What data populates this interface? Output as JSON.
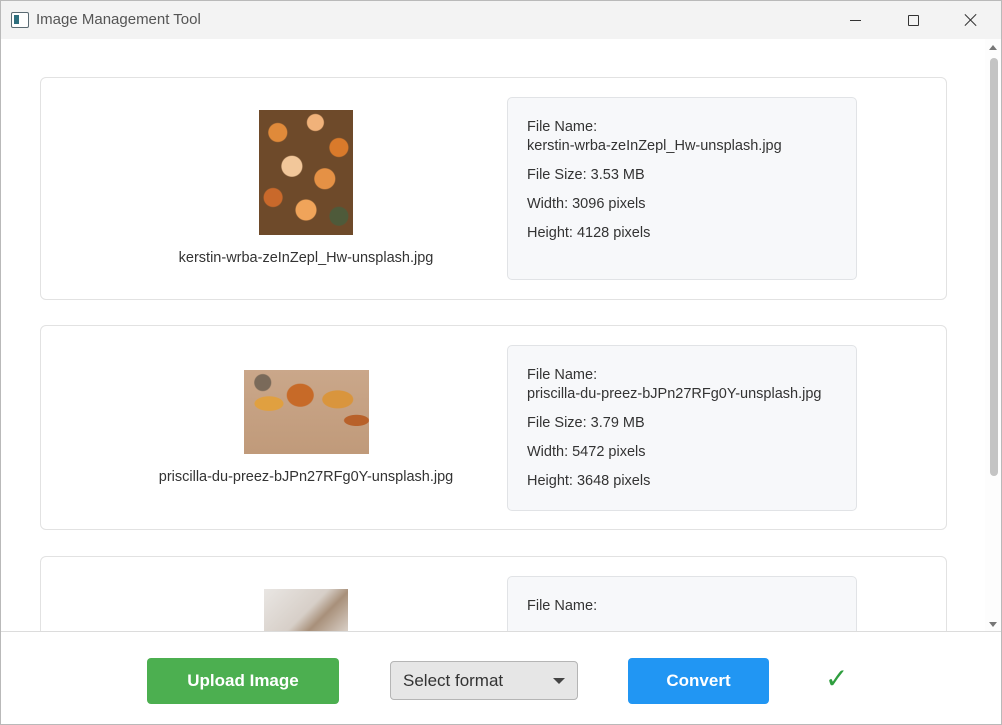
{
  "window": {
    "title": "Image Management Tool"
  },
  "images": [
    {
      "file_name_label": "File Name:",
      "file_name": "kerstin-wrba-zeInZepl_Hw-unsplash.jpg",
      "file_size": "File Size: 3.53 MB",
      "width": "Width: 3096 pixels",
      "height": "Height: 4128 pixels",
      "caption": "kerstin-wrba-zeInZepl_Hw-unsplash.jpg"
    },
    {
      "file_name_label": "File Name:",
      "file_name": "priscilla-du-preez-bJPn27RFg0Y-unsplash.jpg",
      "file_size": "File Size: 3.79 MB",
      "width": "Width: 5472 pixels",
      "height": "Height: 3648 pixels",
      "caption": "priscilla-du-preez-bJPn27RFg0Y-unsplash.jpg"
    },
    {
      "file_name_label": "File Name:"
    }
  ],
  "toolbar": {
    "upload_label": "Upload Image",
    "format_selected": "Select format",
    "convert_label": "Convert",
    "status_icon": "✓"
  },
  "colors": {
    "upload": "#4caf50",
    "convert": "#2196f3",
    "success": "#2e9e3e"
  }
}
